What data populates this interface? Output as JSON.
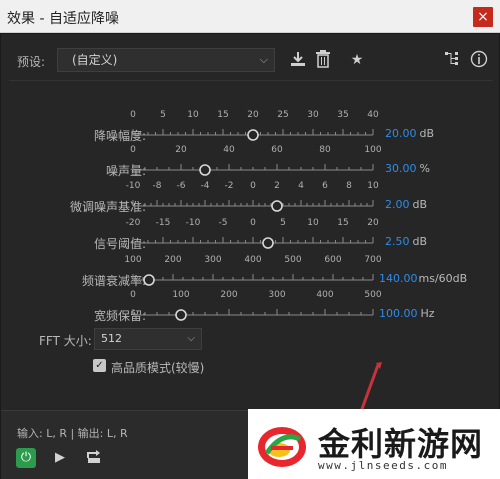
{
  "window": {
    "title": "效果 - 自适应降噪",
    "close_glyph": "×"
  },
  "preset": {
    "label": "预设:",
    "value": "(自定义)",
    "icons": [
      "download-icon",
      "trash-icon",
      "star-icon",
      "routing-icon",
      "help-icon"
    ]
  },
  "params": [
    {
      "label": "降噪幅度:",
      "ticks": [
        "0",
        "5",
        "10",
        "15",
        "20",
        "25",
        "30",
        "35",
        "40"
      ],
      "range": [
        0,
        40
      ],
      "value_num": 20,
      "value": "20.00",
      "unit": "dB"
    },
    {
      "label": "噪声量:",
      "ticks": [
        "0",
        "20",
        "40",
        "60",
        "80",
        "100"
      ],
      "range": [
        0,
        100
      ],
      "value_num": 30,
      "value": "30.00",
      "unit": "%"
    },
    {
      "label": "微调噪声基准:",
      "ticks": [
        "-10",
        "-8",
        "-6",
        "-4",
        "-2",
        "0",
        "2",
        "4",
        "6",
        "8",
        "10"
      ],
      "range": [
        -10,
        10
      ],
      "value_num": 2,
      "value": "2.00",
      "unit": "dB"
    },
    {
      "label": "信号阈值:",
      "ticks": [
        "-20",
        "-15",
        "-10",
        "-5",
        "0",
        "5",
        "10",
        "15",
        "20"
      ],
      "range": [
        -20,
        20
      ],
      "value_num": 2.5,
      "value": "2.50",
      "unit": "dB"
    },
    {
      "label": "频谱衰减率:",
      "ticks": [
        "100",
        "200",
        "300",
        "400",
        "500",
        "600",
        "700"
      ],
      "range": [
        100,
        700
      ],
      "value_num": 140,
      "value": "140.00",
      "unit": "ms/60dB"
    },
    {
      "label": "宽频保留:",
      "ticks": [
        "0",
        "100",
        "200",
        "300",
        "400",
        "500"
      ],
      "range": [
        0,
        500
      ],
      "value_num": 100,
      "value": "100.00",
      "unit": "Hz"
    }
  ],
  "fft": {
    "label": "FFT 大小:",
    "value": "512"
  },
  "hq": {
    "label": "高品质模式(较慢)",
    "checked": true
  },
  "io": {
    "text": "输入: L, R | 输出: L, R"
  },
  "watermark": {
    "title": "金利新游网",
    "url": "www.jlnseeds.com"
  },
  "colors": {
    "accent": "#2d8ceb",
    "power": "#2d9b4e",
    "close": "#c42b1c"
  }
}
